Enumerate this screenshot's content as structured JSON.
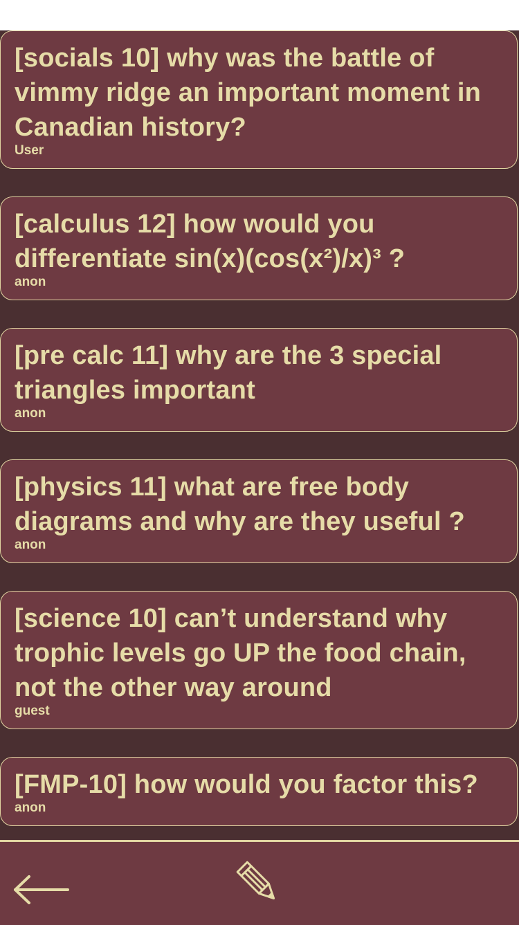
{
  "questions": [
    {
      "text": "[socials 10] why was the battle of vimmy ridge an important moment in Canadian history?",
      "author": "User"
    },
    {
      "text": "[calculus 12] how would you differentiate sin(x)(cos(x²)/x)³ ?",
      "author": "anon"
    },
    {
      "text": "[pre calc 11] why are the 3 special triangles important",
      "author": "anon"
    },
    {
      "text": "[physics 11] what are free body diagrams and why are they useful ?",
      "author": "anon"
    },
    {
      "text": "[science 10] can’t understand why trophic levels go UP the food chain, not the other way around",
      "author": "guest"
    },
    {
      "text": "[FMP-10] how would you factor this?",
      "author": "anon"
    }
  ],
  "toolbar": {
    "back_icon": "arrow-left-icon",
    "compose_icon": "pencil-icon"
  },
  "colors": {
    "background": "#4a2f31",
    "card": "#6e3a42",
    "text": "#e6dca8",
    "border": "#e2d5a2"
  }
}
